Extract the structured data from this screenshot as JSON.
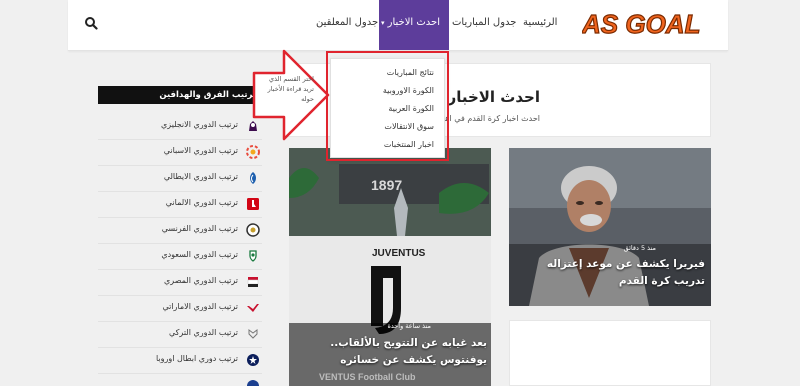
{
  "header": {
    "logo_text": "AS GOAL",
    "nav": [
      {
        "label": "الرئيسية"
      },
      {
        "label": "جدول المباريات"
      },
      {
        "label": "احدث الاخبار"
      },
      {
        "label": "جدول المعلقين"
      }
    ],
    "active_nav_caret": "▾"
  },
  "dropdown": {
    "items": [
      {
        "label": "نتائج المباريات"
      },
      {
        "label": "الكورة الاوروبية"
      },
      {
        "label": "الكورة العربية"
      },
      {
        "label": "سوق الانتقالات"
      },
      {
        "label": "اخبار المنتخبات"
      }
    ]
  },
  "hint_text": "اختر القسم الذي تريد قراءة الأخبار حوله",
  "sidebar": {
    "title": "ترتيب الفرق والهدافين",
    "items": [
      {
        "label": "ترتيب الدوري الانجليزي",
        "icon": "premier-league-icon"
      },
      {
        "label": "ترتيب الدوري الاسباني",
        "icon": "laliga-icon"
      },
      {
        "label": "ترتيب الدوري الايطالي",
        "icon": "serie-a-icon"
      },
      {
        "label": "ترتيب الدوري الالماني",
        "icon": "bundesliga-icon"
      },
      {
        "label": "ترتيب الدوري الفرنسي",
        "icon": "ligue-1-icon"
      },
      {
        "label": "ترتيب الدوري السعودي",
        "icon": "saudi-league-icon"
      },
      {
        "label": "ترتيب الدوري المصري",
        "icon": "egyptian-league-icon"
      },
      {
        "label": "ترتيب الدوري الاماراتي",
        "icon": "uae-league-icon"
      },
      {
        "label": "ترتيب الدوري التركي",
        "icon": "turkish-league-icon"
      },
      {
        "label": "ترتيب دوري ابطال اوروبا",
        "icon": "champions-league-icon"
      }
    ]
  },
  "main": {
    "title": "احدث الاخبار",
    "description": "احدث اخبار كرة القدم في اهم الدوريات والبطولات"
  },
  "cards": [
    {
      "time": "منذ 5 دقائق",
      "title": "فيريرا يكشف عن موعد إعتزاله تدريب كرة القدم"
    },
    {
      "time": "منذ ساعة واحدة",
      "title": "بعد غيابه عن التتويج بالألقاب.. يوفنتوس يكشف عن خسائره"
    }
  ],
  "image_text": {
    "banner_number": "1897",
    "club_name": "JUVENTUS",
    "wall_text": "VENTUS Football Club"
  },
  "colors": {
    "accent": "#5d3d9b",
    "highlight": "#e0242e",
    "logo": "#f0641e"
  }
}
